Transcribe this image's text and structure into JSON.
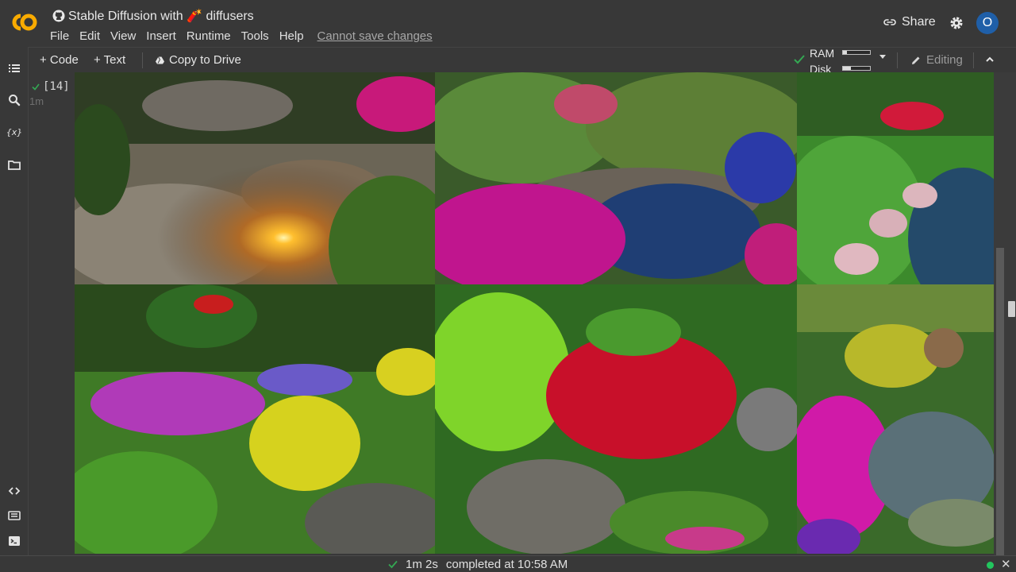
{
  "app": {
    "title": "Stable Diffusion with 🧨 diffusers",
    "logo_icon": "colab-logo-icon",
    "accent": "#f9ab00"
  },
  "menu": {
    "items": [
      "File",
      "Edit",
      "View",
      "Insert",
      "Runtime",
      "Tools",
      "Help"
    ],
    "save_notice": "Cannot save changes"
  },
  "header": {
    "share_label": "Share",
    "avatar_initial": "O"
  },
  "toolbar": {
    "add_code": "+ Code",
    "add_text": "+ Text",
    "copy_to_drive": "Copy to Drive",
    "ram_label": "RAM",
    "disk_label": "Disk",
    "ram_usage": 0.15,
    "disk_usage": 0.3,
    "editing_label": "Editing"
  },
  "cell": {
    "execution_count": "[14]",
    "elapsed": "1m"
  },
  "output": {
    "image_grid": {
      "rows": 2,
      "cols": 3,
      "subject": "garden flower images"
    }
  },
  "statusbar": {
    "duration": "1m 2s",
    "completed": "completed at 10:58 AM",
    "indicator_color": "#22c55e"
  }
}
